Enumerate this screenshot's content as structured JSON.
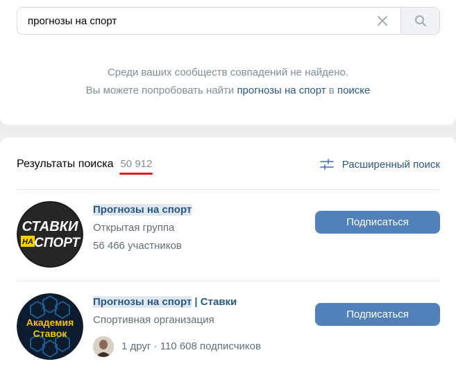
{
  "search": {
    "query": "прогнозы на спорт",
    "clear_icon": "close-icon",
    "search_icon": "search-icon"
  },
  "empty_message": {
    "line1": "Среди ваших сообществ совпадений не найдено.",
    "line2_prefix": "Вы можете попробовать найти ",
    "line2_link": "прогнозы на спорт",
    "line2_middle": " в ",
    "line2_search_link": "поиске"
  },
  "results": {
    "title": "Результаты поиска",
    "count": "50 912",
    "advanced_search_label": "Расширенный поиск",
    "items": [
      {
        "name_highlight": "Прогнозы на спорт",
        "name_rest": "",
        "type": "Открытая группа",
        "members": "56 466 участников",
        "button_label": "Подписаться",
        "avatar_text_1": "СТАВКИ",
        "avatar_text_2": "НА",
        "avatar_text_3": "СПОРТ"
      },
      {
        "name_highlight": "Прогнозы на спорт",
        "name_rest": " | Ставки",
        "type": "Спортивная организация",
        "members": "1 друг · 110 608 подписчиков",
        "button_label": "Подписаться",
        "avatar_text_1": "Академия",
        "avatar_text_2": "Ставок"
      }
    ]
  },
  "colors": {
    "link": "#2a5885",
    "button": "#5181b8",
    "underline": "#e31f1f",
    "muted": "#818c99"
  }
}
